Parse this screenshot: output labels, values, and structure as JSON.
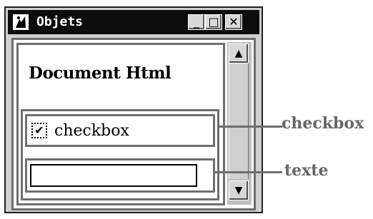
{
  "window": {
    "title": "Objets",
    "minimize_glyph": "_",
    "maximize_glyph": "□",
    "close_glyph": "✕"
  },
  "document": {
    "heading": "Document Html",
    "checkbox_label": "checkbox",
    "checkbox_checked": true,
    "checkbox_mark": "✔",
    "text_value": ""
  },
  "scrollbar": {
    "up_glyph": "▲",
    "down_glyph": "▼"
  },
  "callouts": {
    "checkbox": "checkbox",
    "texte": "texte"
  },
  "colors": {
    "titlebar": "#0c0c0c",
    "frame_gray": "#6e6e6e",
    "callout_text": "#666666"
  }
}
